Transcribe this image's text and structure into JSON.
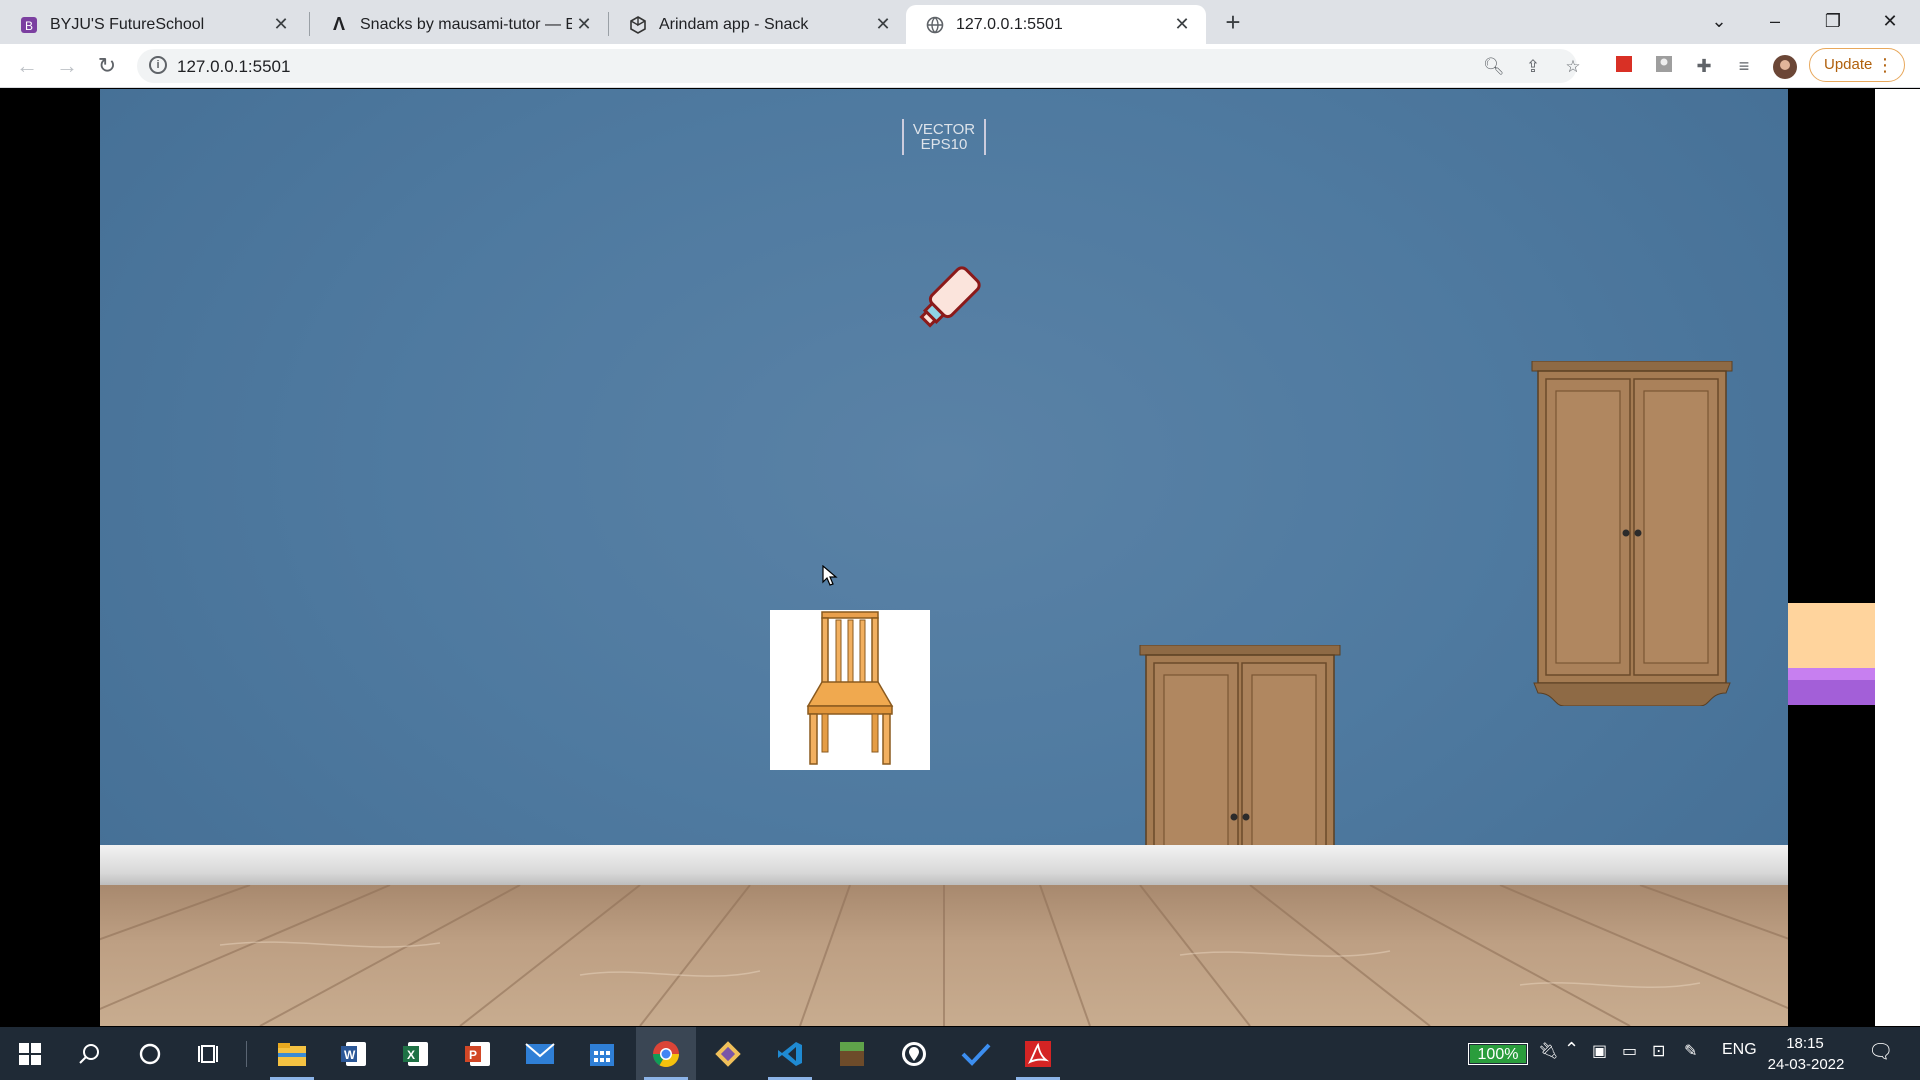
{
  "browser": {
    "tabs": [
      {
        "title": "BYJU'S FutureSchool",
        "icon": "byjus-icon"
      },
      {
        "title": "Snacks by mausami-tutor — Expo",
        "icon": "expo-icon"
      },
      {
        "title": "Arindam app - Snack",
        "icon": "snack-icon"
      },
      {
        "title": "127.0.0.1:5501",
        "icon": "globe-icon",
        "active": true
      }
    ],
    "url": "127.0.0.1:5501",
    "update_label": "Update"
  },
  "page": {
    "watermark_line1": "VECTOR",
    "watermark_line2": "EPS10",
    "objects": [
      "bottle",
      "chair",
      "wardrobe",
      "wardrobe"
    ]
  },
  "taskbar": {
    "apps": [
      "start",
      "search",
      "cortana",
      "task-view",
      "file-explorer",
      "word",
      "excel",
      "powerpoint",
      "mail",
      "calendar",
      "chrome",
      "git",
      "vscode",
      "minecraft",
      "maps",
      "todo",
      "acrobat"
    ],
    "battery": "100%",
    "language": "ENG",
    "time": "18:15",
    "date": "24-03-2022"
  }
}
